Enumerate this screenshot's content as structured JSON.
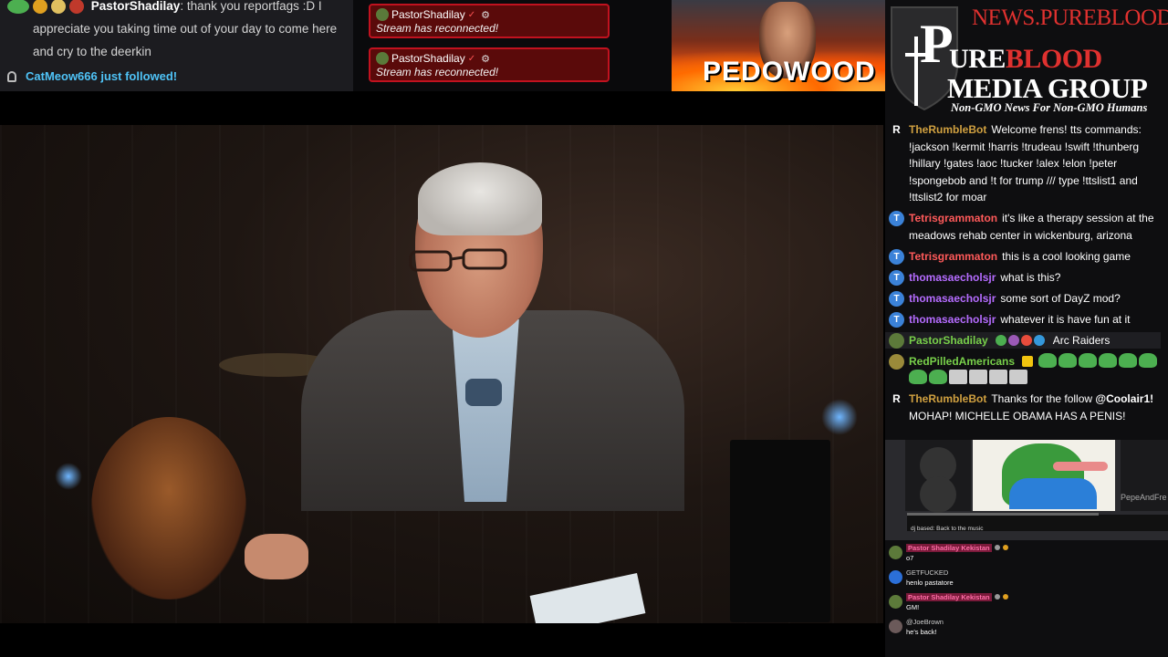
{
  "top_chat": {
    "message": {
      "user": "PastorShadilay",
      "text_line1": "thank you reportfags :D I",
      "text_line2": "appreciate you taking time out of your day to come here",
      "text_line3": "and cry to the deerkin"
    },
    "follow": {
      "text": "CatMeow666 just followed!"
    }
  },
  "alerts": [
    {
      "user": "PastorShadilay",
      "message": "Stream has reconnected!"
    },
    {
      "user": "PastorShadilay",
      "message": "Stream has reconnected!"
    }
  ],
  "promo": {
    "text": "PEDOWOOD"
  },
  "logo": {
    "url": "NEWS.PUREBLOOD.MEDIA",
    "big_letter": "P",
    "line1_a": "URE",
    "line1_b": "BLOOD",
    "line2": "MEDIA GROUP",
    "tagline": "Non-GMO News For Non-GMO Humans"
  },
  "chat": {
    "messages": [
      {
        "avatar": "R",
        "user": "TheRumbleBot",
        "text": "Welcome frens! tts commands: !jackson !kermit !harris !trudeau !swift !thunberg !hillary !gates !aoc !tucker !alex !elon !peter !spongebob and !t for trump /// type !ttslist1 and !ttslist2 for moar"
      },
      {
        "avatar": "T",
        "user": "Tetrisgrammaton",
        "text": "it's like a therapy session at the meadows rehab center in wickenburg, arizona"
      },
      {
        "avatar": "T",
        "user": "Tetrisgrammaton",
        "text": "this is a cool looking game"
      },
      {
        "avatar": "T",
        "user": "thomasaecholsjr",
        "text": "what is this?"
      },
      {
        "avatar": "T",
        "user": "thomasaecholsjr",
        "text": "some sort of DayZ mod?"
      },
      {
        "avatar": "T",
        "user": "thomasaecholsjr",
        "text": "whatever it is have fun at it"
      },
      {
        "avatar": "",
        "user": "PastorShadilay",
        "text": "Arc Raiders"
      },
      {
        "avatar": "",
        "user": "RedPilledAmericans",
        "text": ""
      },
      {
        "avatar": "R",
        "user": "TheRumbleBot",
        "text_a": "Thanks for the follow",
        "mention": "@Coolair1!",
        "text_b": "MOHAP! MICHELLE OBAMA HAS A PENIS!"
      }
    ]
  },
  "media": {
    "watermark": "PepeAndFre",
    "label": "dj based: Back to the music"
  },
  "chat2": {
    "messages": [
      {
        "user": "Pastor Shadilay Kekistan",
        "text": "o7"
      },
      {
        "user": "GETFUCKED",
        "text": "henlo pastatore"
      },
      {
        "user": "Pastor Shadilay Kekistan",
        "text": "GM!"
      },
      {
        "user": "@JoeBrown",
        "text": "he's back!"
      }
    ]
  },
  "colors": {
    "alert_bg": "#5a0a0a",
    "alert_border": "#c1121f",
    "brand_red": "#e0312f",
    "rumble_bot": "#d0a040",
    "tetris": "#ff5a5a",
    "thomas": "#b56cff",
    "pastor": "#78d04a"
  }
}
